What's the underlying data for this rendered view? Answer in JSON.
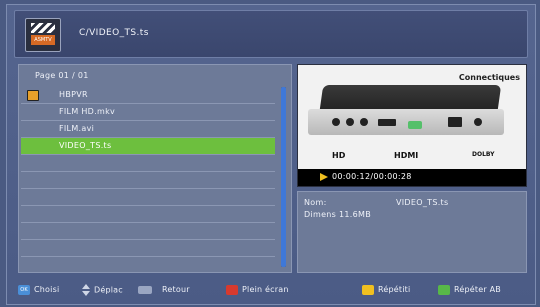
{
  "header": {
    "path": "C/VIDEO_TS.ts",
    "logo_text": "ASMTV"
  },
  "list": {
    "page_info": "Page  01 / 01",
    "items": [
      {
        "label": "HBPVR",
        "type": "folder",
        "selected": false
      },
      {
        "label": "FILM HD.mkv",
        "type": "file",
        "selected": false
      },
      {
        "label": "FILM.avi",
        "type": "file",
        "selected": false
      },
      {
        "label": "VIDEO_TS.ts",
        "type": "file",
        "selected": true
      }
    ],
    "total_rows": 12
  },
  "preview": {
    "brand_text": "Connectiques",
    "logo_hd": "HD",
    "logo_hdmi": "HDMI",
    "logo_dolby": "DOLBY",
    "time": "00:00:12/00:00:28"
  },
  "info": {
    "name_label": "Nom:",
    "name_value": "VIDEO_TS.ts",
    "size": "Dimens 11.6MB"
  },
  "footer": {
    "ok_key": "OK",
    "choose": "Choisi",
    "move": "Déplac",
    "back": "Retour",
    "fullscreen": "Plein écran",
    "repeat": "Répétiti",
    "repeat_ab": "Répéter AB"
  },
  "colors": {
    "background": "#4a5a82",
    "selected_row": "#6dbf3e",
    "scroll_thumb": "#3f78d8",
    "red_key": "#d83a2e",
    "yellow_key": "#f0c020",
    "green_key": "#58b848"
  }
}
